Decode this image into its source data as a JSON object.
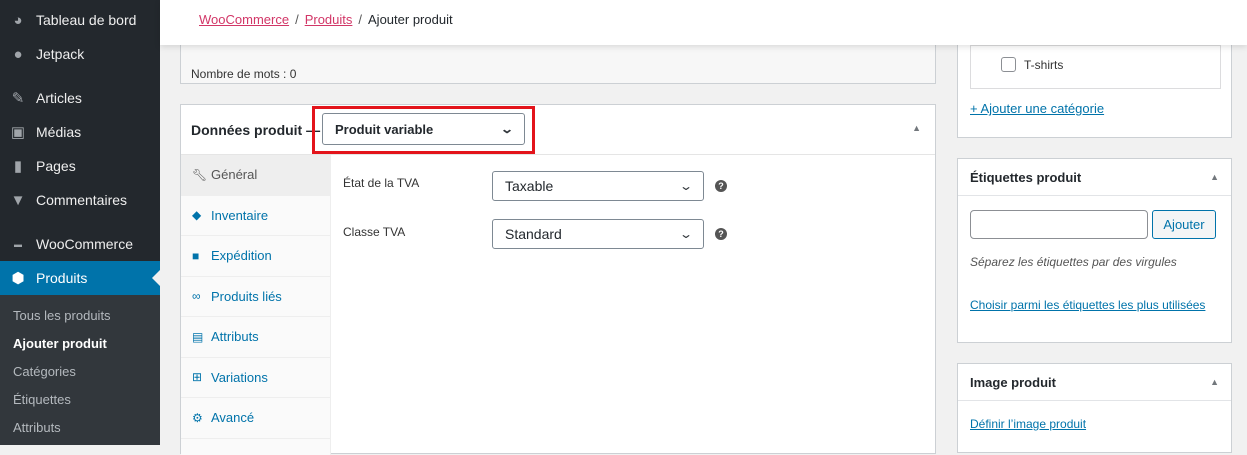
{
  "sidebar": {
    "items": [
      {
        "label": "Tableau de bord",
        "icon": "dashboard-icon"
      },
      {
        "label": "Jetpack",
        "icon": "jetpack-icon"
      },
      {
        "label": "Articles",
        "icon": "pin-icon"
      },
      {
        "label": "Médias",
        "icon": "media-icon"
      },
      {
        "label": "Pages",
        "icon": "pages-icon"
      },
      {
        "label": "Commentaires",
        "icon": "comment-icon"
      },
      {
        "label": "WooCommerce",
        "icon": "woo-icon"
      },
      {
        "label": "Produits",
        "icon": "box-icon"
      }
    ],
    "submenu": [
      "Tous les produits",
      "Ajouter produit",
      "Catégories",
      "Étiquettes",
      "Attributs"
    ]
  },
  "breadcrumb": {
    "woo": "WooCommerce",
    "products": "Produits",
    "current": "Ajouter produit",
    "sep": "/"
  },
  "editor": {
    "word_count": "Nombre de mots : 0"
  },
  "product_data": {
    "title": "Données produit —",
    "type": "Produit variable",
    "tabs": [
      "Général",
      "Inventaire",
      "Expédition",
      "Produits liés",
      "Attributs",
      "Variations",
      "Avancé"
    ],
    "fields": [
      {
        "label": "État de la TVA",
        "value": "Taxable"
      },
      {
        "label": "Classe TVA",
        "value": "Standard"
      }
    ]
  },
  "categories": {
    "item": "T-shirts",
    "add": "+ Ajouter une catégorie"
  },
  "tags": {
    "title": "Étiquettes produit",
    "button": "Ajouter",
    "hint": "Séparez les étiquettes par des virgules",
    "link": "Choisir parmi les étiquettes les plus utilisées"
  },
  "image": {
    "title": "Image produit",
    "link": "Définir l’image produit"
  },
  "colors": {
    "accent": "#0073aa",
    "sidebar": "#23282d",
    "highlight": "#e3141b",
    "crumb": "#d23667"
  }
}
